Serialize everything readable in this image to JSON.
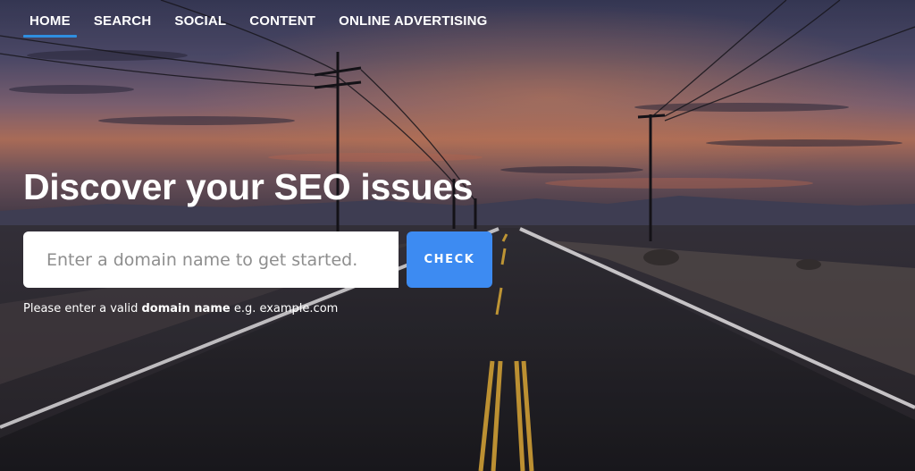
{
  "nav": {
    "items": [
      {
        "label": "HOME",
        "active": true
      },
      {
        "label": "SEARCH",
        "active": false
      },
      {
        "label": "SOCIAL",
        "active": false
      },
      {
        "label": "CONTENT",
        "active": false
      },
      {
        "label": "ONLINE ADVERTISING",
        "active": false
      }
    ]
  },
  "hero": {
    "headline": "Discover your SEO issues",
    "input_placeholder": "Enter a domain name to get started.",
    "input_value": "",
    "check_label": "CHECK",
    "hint_prefix": "Please enter a valid ",
    "hint_bold": "domain name",
    "hint_suffix": " e.g. example.com"
  },
  "colors": {
    "accent": "#3d8bf2",
    "nav_underline": "#2f8fe0"
  }
}
